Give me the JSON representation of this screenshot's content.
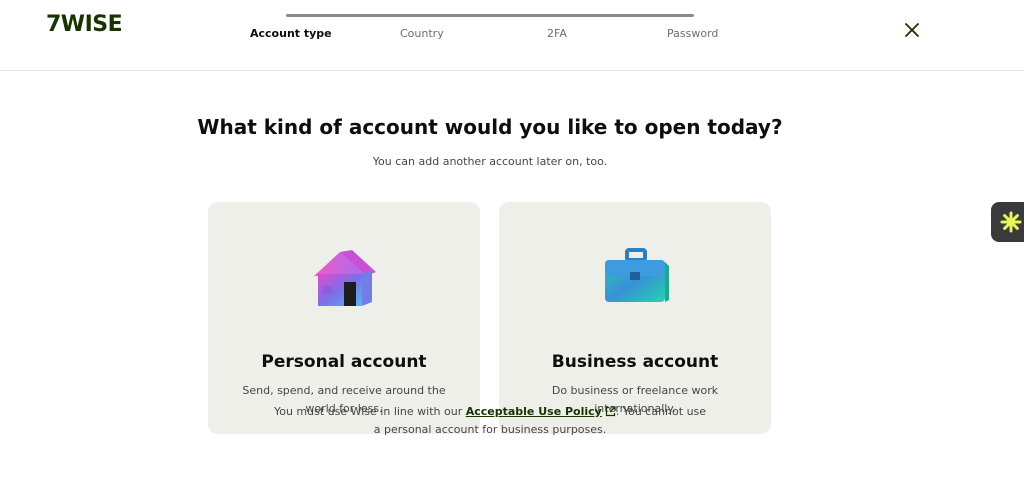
{
  "header": {
    "logo_text": "7WISE",
    "steps": [
      "Account type",
      "Country",
      "2FA",
      "Password"
    ],
    "active_step": "Account type",
    "close_icon": "close-icon"
  },
  "main": {
    "title": "What kind of account would you like to open today?",
    "subtitle": "You can add another account later on, too.",
    "cards": [
      {
        "title": "Personal account",
        "description": "Send, spend, and receive around the world for less.",
        "icon": "house-icon"
      },
      {
        "title": "Business account",
        "description": "Do business or freelance work internationally.",
        "icon": "briefcase-icon"
      }
    ]
  },
  "footer": {
    "prefix": "You must use Wise in line with our ",
    "link_text": "Acceptable Use Policy",
    "suffix": ". You cannot use a personal account for business purposes."
  },
  "widget": {
    "icon": "asterisk-icon",
    "accent": "#e7f55b"
  },
  "colors": {
    "brand": "#163300",
    "card_bg": "#efefea"
  }
}
